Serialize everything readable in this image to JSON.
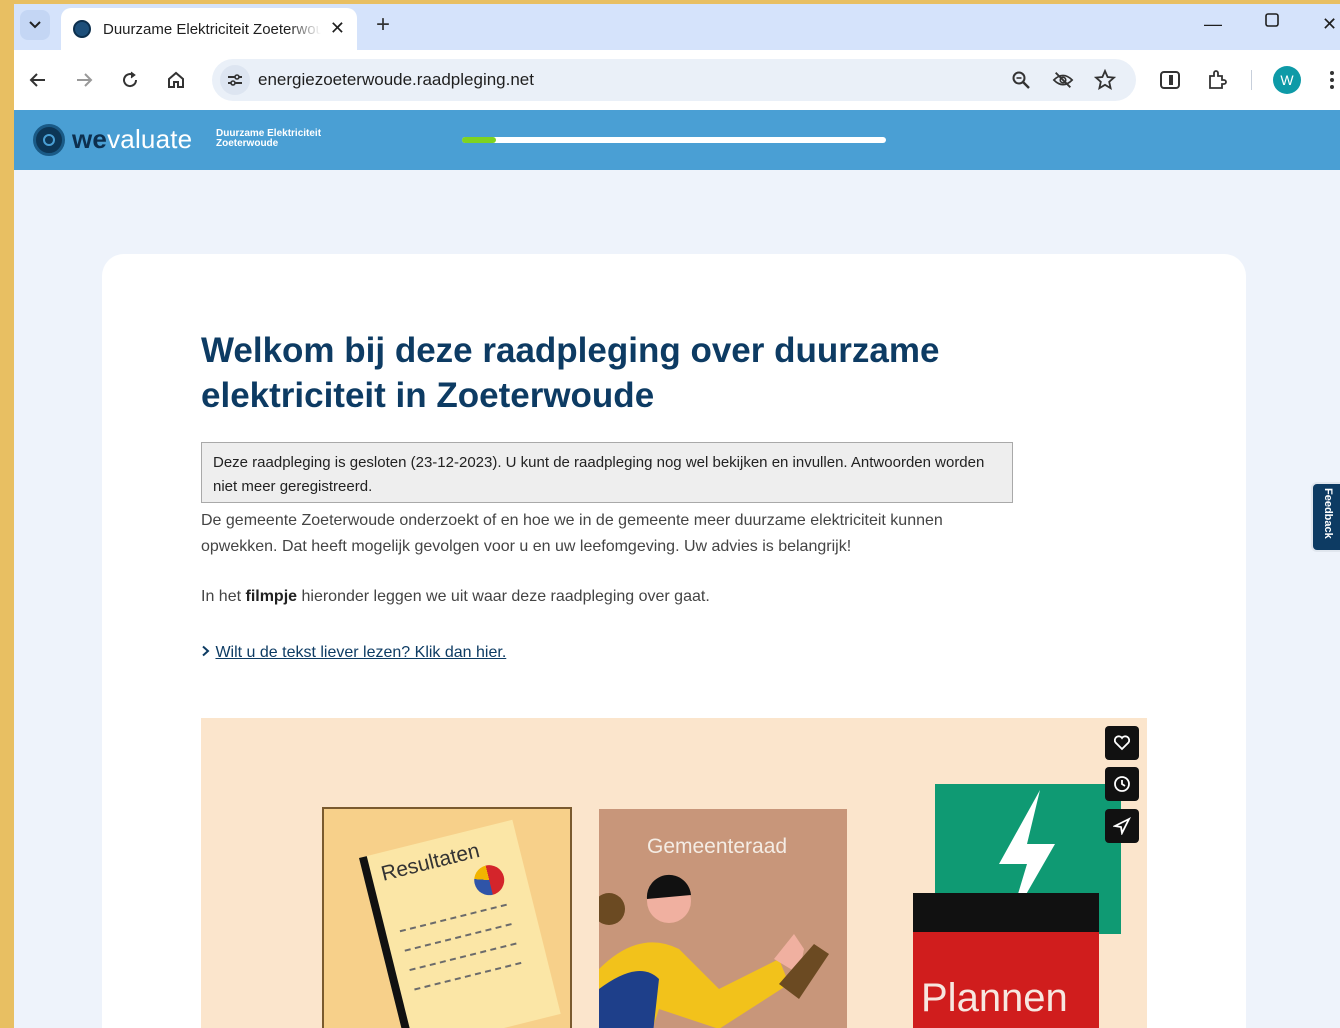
{
  "browser": {
    "tab_title": "Duurzame Elektriciteit Zoeterwoude",
    "url": "energiezoeterwoude.raadpleging.net",
    "profile_initial": "W",
    "icons": [
      "tab-search-icon",
      "close-icon",
      "new-tab-icon",
      "minimize-icon",
      "maximize-icon",
      "window-close-icon",
      "back-icon",
      "forward-icon",
      "reload-icon",
      "home-icon",
      "site-info-icon",
      "zoom-icon",
      "eye-off-icon",
      "star-icon",
      "reading-mode-icon",
      "extensions-icon",
      "menu-icon"
    ]
  },
  "site": {
    "logo_we": "we",
    "logo_rest": "valuate",
    "project_name": "Duurzame Elektriciteit Zoeterwoude",
    "progress": 0.08,
    "accent": "#4a9fd4",
    "progress_color": "#7ed321"
  },
  "content": {
    "title": "Welkom bij deze raadpleging over duurzame elektriciteit in Zoeterwoude",
    "closed_notice": "Deze raadpleging is gesloten (23-12-2023). U kunt de raadpleging nog wel bekijken en invullen. Antwoorden worden niet meer geregistreerd.",
    "intro": "De gemeente Zoeterwoude onderzoekt of en hoe we in de gemeente meer duurzame elektriciteit kunnen opwekken. Dat heeft mogelijk gevolgen voor u en uw leefomgeving. Uw advies is belangrijk!",
    "film_prefix": "In het ",
    "film_bold": "filmpje",
    "film_suffix": " hieronder leggen we uit waar deze raadpleging over gaat.",
    "read_link": "Wilt u de tekst liever lezen? Klik dan hier."
  },
  "video": {
    "results_label": "Resultaten",
    "council_label": "Gemeenteraad",
    "plans_label": "Plannen",
    "buttons": [
      "heart-icon",
      "clock-icon",
      "share-icon"
    ]
  },
  "feedback": {
    "label": "Feedback"
  }
}
